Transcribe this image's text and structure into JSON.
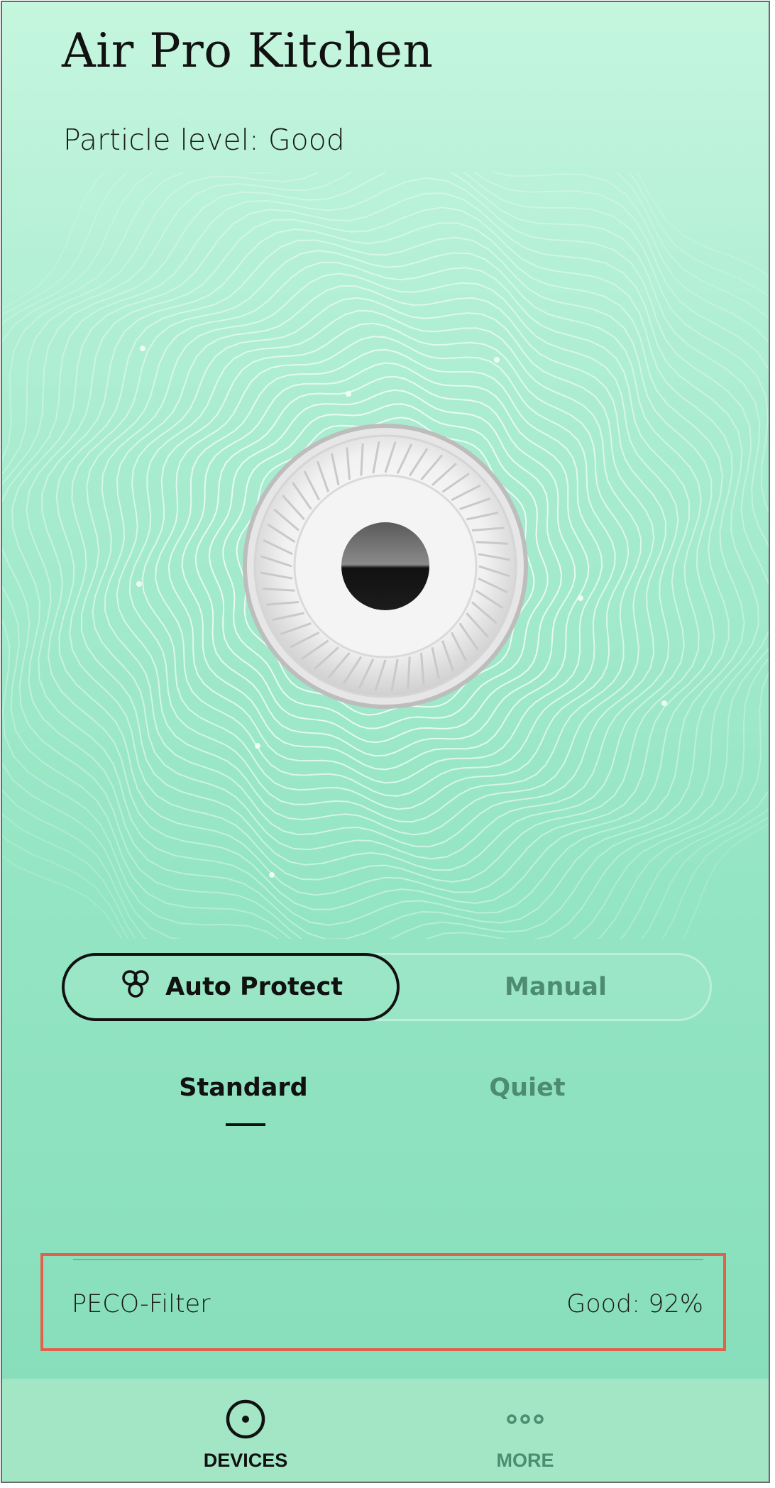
{
  "header": {
    "title": "Air Pro Kitchen",
    "particle_level": "Particle level: Good"
  },
  "mode_toggle": {
    "active_label": "Auto Protect",
    "active_icon": "fan-trefoil-icon",
    "inactive_label": "Manual"
  },
  "sub_modes": {
    "selected": "Standard",
    "other": "Quiet"
  },
  "filter": {
    "name": "PECO-Filter",
    "status": "Good: 92%",
    "percent": 92
  },
  "bottom_nav": {
    "devices_label": "DEVICES",
    "devices_icon": "device-target-icon",
    "more_label": "MORE",
    "more_icon": "more-dots-icon"
  },
  "colors": {
    "background_top": "#c5f6de",
    "background_bottom": "#85ddb9",
    "inactive_text": "#4d8c6e",
    "highlight_border": "#e0624d"
  }
}
